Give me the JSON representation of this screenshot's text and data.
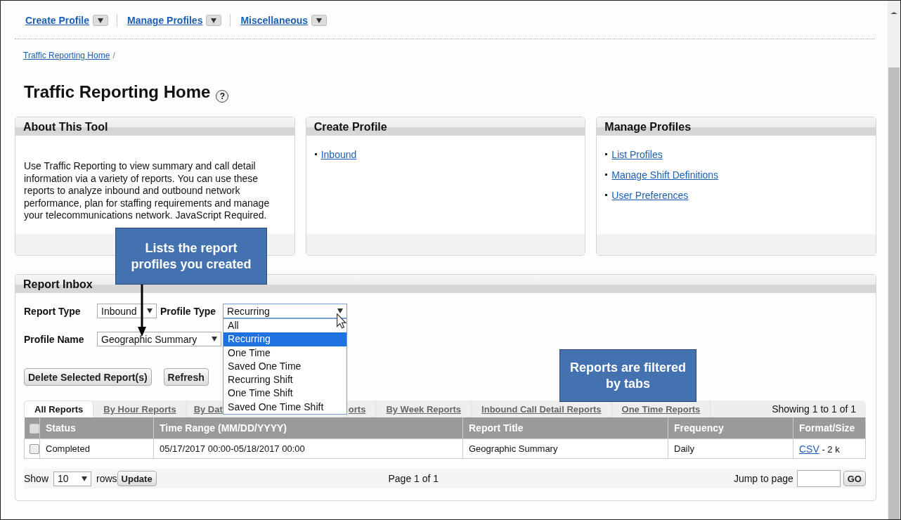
{
  "nav_menu": [
    {
      "label": "Create Profile"
    },
    {
      "label": "Manage Profiles"
    },
    {
      "label": "Miscellaneous"
    }
  ],
  "breadcrumb": {
    "link": "Traffic Reporting Home",
    "separator": "/"
  },
  "page_title": {
    "text": "Traffic Reporting Home",
    "help": "?"
  },
  "panels": [
    {
      "title": "About This Tool",
      "kind": "text",
      "text": "Use Traffic Reporting to view summary and call detail information via a variety of reports. You can use these reports to analyze inbound and outbound network performance, plan for staffing requirements and manage your telecommunications network. JavaScript Required."
    },
    {
      "title": "Create Profile",
      "kind": "links",
      "links": [
        "Inbound"
      ]
    },
    {
      "title": "Manage Profiles",
      "kind": "links",
      "links": [
        "List Profiles",
        "Manage Shift Definitions",
        "User Preferences"
      ]
    }
  ],
  "report_inbox": {
    "title": "Report Inbox",
    "report_type": {
      "label": "Report Type",
      "value": "Inbound"
    },
    "profile_type": {
      "label": "Profile Type",
      "value": "Recurring",
      "expanded": true,
      "options": [
        {
          "label": "All",
          "selected": false
        },
        {
          "label": "Recurring",
          "selected": true
        },
        {
          "label": "One Time",
          "selected": false
        },
        {
          "label": "Saved One Time",
          "selected": false
        },
        {
          "label": "Recurring Shift",
          "selected": false
        },
        {
          "label": "One Time Shift",
          "selected": false
        },
        {
          "label": "Saved One Time Shift",
          "selected": false
        }
      ]
    },
    "profile_name": {
      "label": "Profile Name",
      "value": "Geographic Summary"
    },
    "buttons": [
      "Delete Selected Report(s)",
      "Refresh"
    ],
    "tabs": [
      {
        "label": "All Reports",
        "selected": true
      },
      {
        "label": "By Hour Reports",
        "selected": false
      },
      {
        "label": "By Dat",
        "selected": false
      },
      {
        "label": "orts",
        "selected": false
      },
      {
        "label": "By Week Reports",
        "selected": false
      },
      {
        "label": "Inbound Call Detail Reports",
        "selected": false
      },
      {
        "label": "One Time Reports",
        "selected": false
      }
    ],
    "showing": "Showing 1 to 1 of 1",
    "table": {
      "all_checked": false,
      "columns": [
        "Status",
        "Time Range (MM/DD/YYYY)",
        "Report Title",
        "Frequency",
        "Format/Size"
      ],
      "rows": [
        {
          "checked": false,
          "status": "Completed",
          "time_range": "05/17/2017 00:00-05/18/2017 00:00",
          "report_title": "Geographic Summary",
          "frequency": "Daily",
          "format_link": "CSV",
          "size": "- 2 k"
        }
      ]
    },
    "footer": {
      "show": "Show",
      "rows_value": "10",
      "rows": "rows",
      "update": "Update",
      "page": "Page 1 of 1",
      "jump": "Jump to page",
      "go": "GO"
    }
  },
  "callouts": [
    {
      "text": "Lists the report profiles you created"
    },
    {
      "text": "Reports are filtered by tabs"
    }
  ]
}
